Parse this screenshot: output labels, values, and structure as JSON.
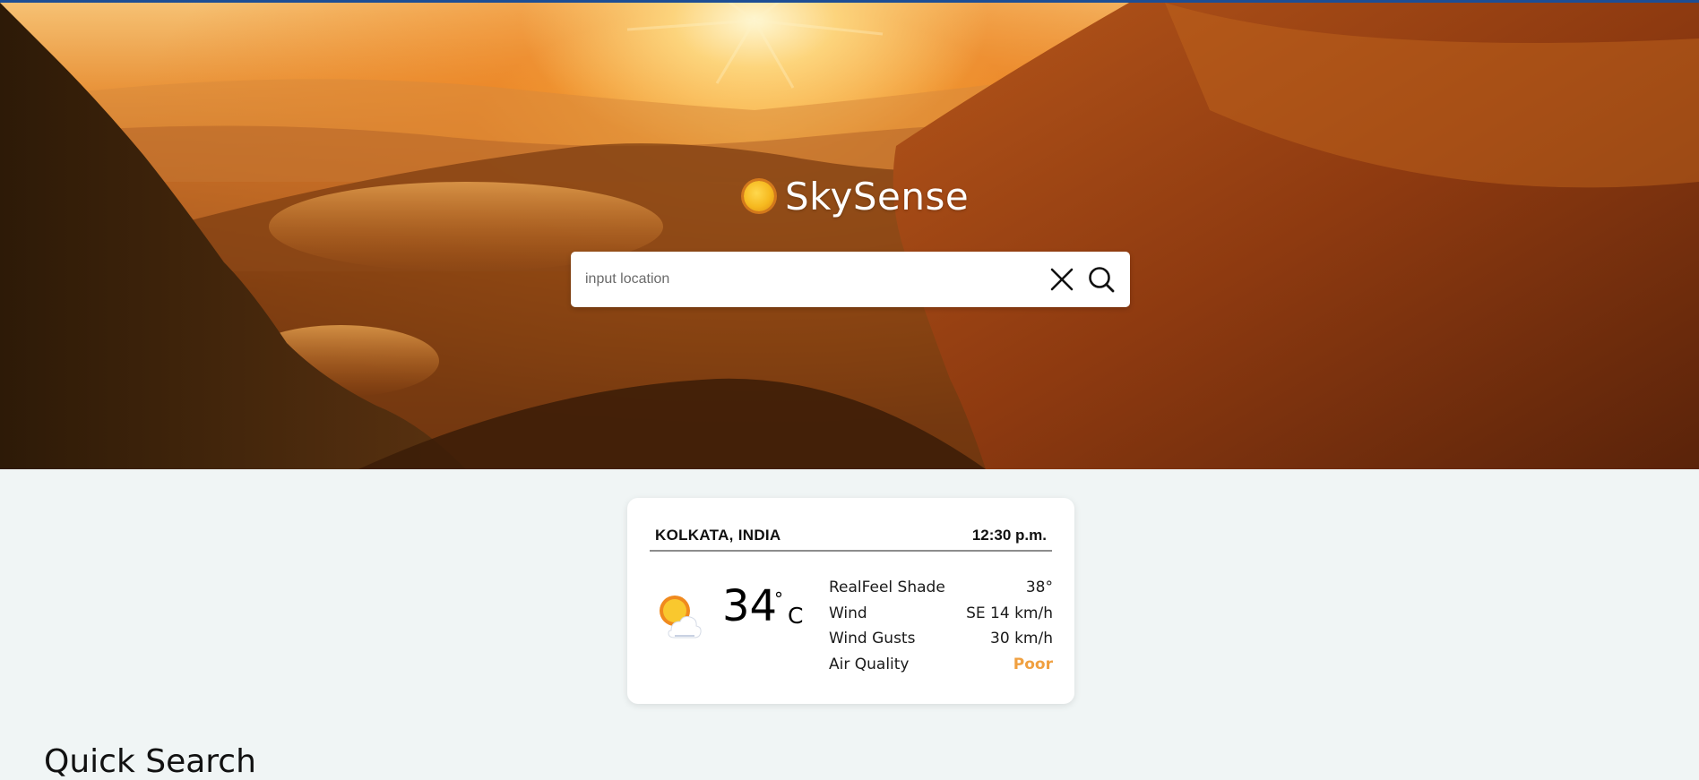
{
  "app": {
    "brand_name": "SkySense",
    "logo_icon": "sun-icon"
  },
  "search": {
    "placeholder": "input location",
    "value": "",
    "clear_icon": "close-icon",
    "search_icon": "search-icon"
  },
  "weather": {
    "location": "KOLKATA, INDIA",
    "time": "12:30 p.m.",
    "condition_icon": "partly-sunny-icon",
    "temperature": "34",
    "degree_symbol": "°",
    "unit": "C",
    "details": [
      {
        "label": "RealFeel Shade",
        "value": "38°"
      },
      {
        "label": "Wind",
        "value": "SE 14 km/h"
      },
      {
        "label": "Wind Gusts",
        "value": "30 km/h"
      },
      {
        "label": "Air Quality",
        "value": "Poor"
      }
    ]
  },
  "sections": {
    "quick_search_title": "Quick Search"
  },
  "colors": {
    "top_bar": "#1d4e95",
    "page_background": "#f0f5f5",
    "air_quality_poor": "#f0a040"
  }
}
